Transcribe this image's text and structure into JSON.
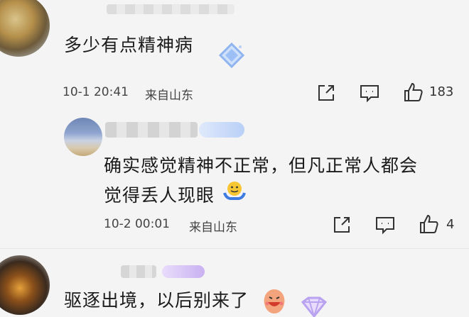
{
  "comments": [
    {
      "text": "多少有点精神病",
      "time": "10-1 20:41",
      "location": "来自山东",
      "likes": "183"
    },
    {
      "text_line1": "确实感觉精神不正常，但凡正常人都会",
      "text_line2": "觉得丢人现眼",
      "time": "10-2 00:01",
      "location": "来自山东",
      "likes": "4"
    },
    {
      "text": "驱逐出境，以后别来了"
    }
  ],
  "icons": {
    "share": "share-icon",
    "comment": "comment-icon",
    "like": "thumbs-up-icon",
    "badge": "diamond-badge-icon",
    "emoji_shrug": "shrug-emoji-icon",
    "emoji_laugh": "laugh-emoji-icon"
  },
  "colors": {
    "background": "#f4f4f4",
    "text": "#1b1b1b",
    "meta": "#444444",
    "badge_blue": "#8fb4f0",
    "badge_purple": "#b9a3f0"
  }
}
